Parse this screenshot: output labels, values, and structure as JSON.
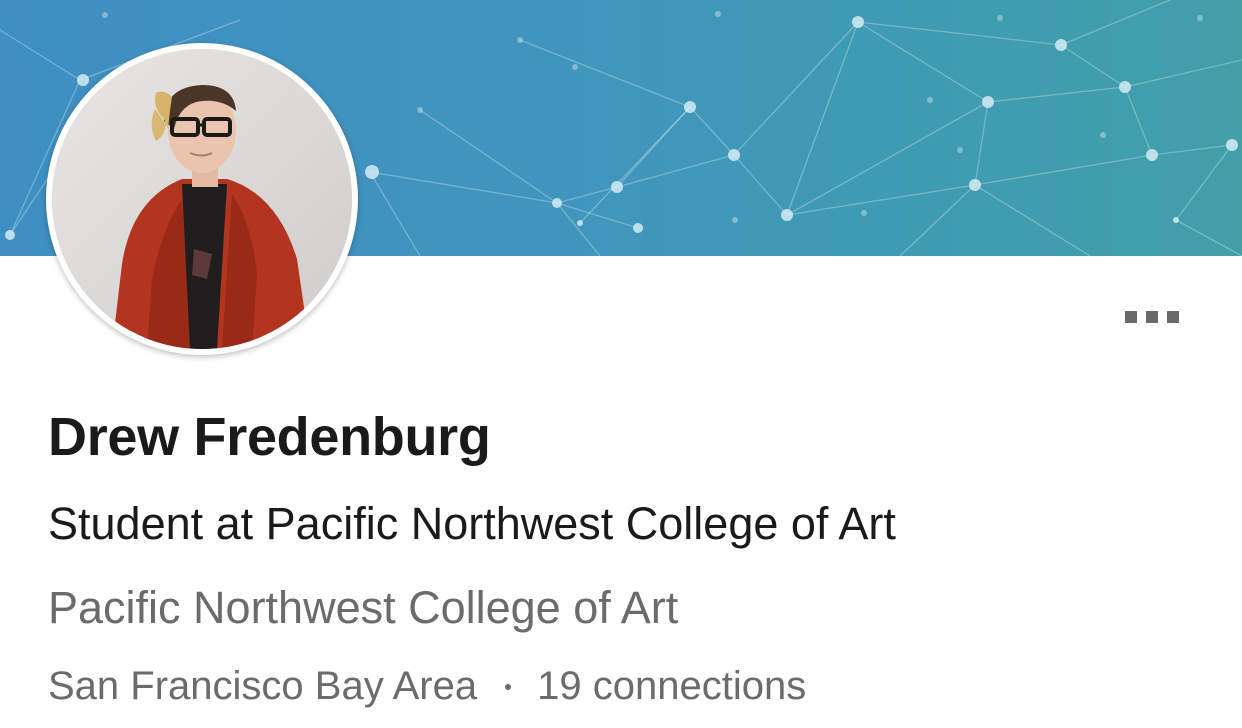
{
  "profile": {
    "name": "Drew Fredenburg",
    "headline": "Student at Pacific Northwest College of Art",
    "school": "Pacific Northwest College of Art",
    "location": "San Francisco Bay Area",
    "connections": "19 connections"
  },
  "icons": {
    "more": "more-horizontal-icon"
  },
  "colors": {
    "cover_start": "#3f8fc2",
    "cover_end": "#429fa8",
    "name_text": "#1a1a1a",
    "secondary_text": "#6b6b6b"
  }
}
